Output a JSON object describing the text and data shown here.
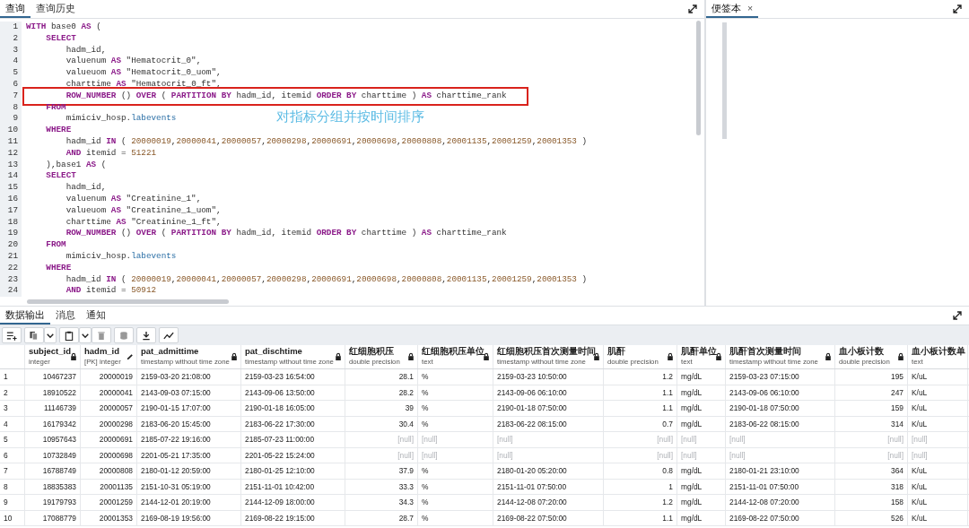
{
  "editor_tabs": [
    {
      "label": "查询",
      "selected": true
    },
    {
      "label": "查询历史",
      "selected": false
    }
  ],
  "code_lines": [
    {
      "n": "1",
      "highlighted": false,
      "tokens": [
        {
          "kind": "kw",
          "text": "WITH"
        },
        {
          "kind": "tx",
          "text": " base0 "
        },
        {
          "kind": "kw",
          "text": "AS"
        },
        {
          "kind": "tx",
          "text": " ("
        }
      ]
    },
    {
      "n": "2",
      "highlighted": false,
      "tokens": [
        {
          "kind": "kw",
          "text": "    SELECT"
        }
      ]
    },
    {
      "n": "3",
      "highlighted": false,
      "tokens": [
        {
          "kind": "tx",
          "text": "        hadm_id,"
        }
      ]
    },
    {
      "n": "4",
      "highlighted": false,
      "tokens": [
        {
          "kind": "tx",
          "text": "        valuenum "
        },
        {
          "kind": "kw",
          "text": "AS"
        },
        {
          "kind": "tx",
          "text": " \"Hematocrit_0\","
        }
      ]
    },
    {
      "n": "5",
      "highlighted": false,
      "tokens": [
        {
          "kind": "tx",
          "text": "        valueuom "
        },
        {
          "kind": "kw",
          "text": "AS"
        },
        {
          "kind": "tx",
          "text": " \"Hematocrit_0_uom\","
        }
      ]
    },
    {
      "n": "6",
      "highlighted": false,
      "tokens": [
        {
          "kind": "tx",
          "text": "        charttime "
        },
        {
          "kind": "kw",
          "text": "AS"
        },
        {
          "kind": "tx",
          "text": " \"Hematocrit_0_ft\","
        }
      ]
    },
    {
      "n": "7",
      "highlighted": true,
      "tokens": [
        {
          "kind": "kw",
          "text": "        ROW_NUMBER"
        },
        {
          "kind": "tx",
          "text": " () "
        },
        {
          "kind": "kw",
          "text": "OVER"
        },
        {
          "kind": "tx",
          "text": " ( "
        },
        {
          "kind": "kw",
          "text": "PARTITION BY"
        },
        {
          "kind": "tx",
          "text": " hadm_id, itemid "
        },
        {
          "kind": "kw",
          "text": "ORDER BY"
        },
        {
          "kind": "tx",
          "text": " charttime ) "
        },
        {
          "kind": "kw",
          "text": "AS"
        },
        {
          "kind": "tx",
          "text": " charttime_rank"
        }
      ]
    },
    {
      "n": "8",
      "highlighted": false,
      "tokens": [
        {
          "kind": "kw",
          "text": "    FROM"
        }
      ]
    },
    {
      "n": "9",
      "highlighted": false,
      "tokens": [
        {
          "kind": "tx",
          "text": "        mimiciv_hosp."
        },
        {
          "kind": "fn",
          "text": "labevents"
        }
      ]
    },
    {
      "n": "10",
      "highlighted": false,
      "tokens": [
        {
          "kind": "kw",
          "text": "    WHERE"
        }
      ]
    },
    {
      "n": "11",
      "highlighted": false,
      "tokens": [
        {
          "kind": "tx",
          "text": "        hadm_id "
        },
        {
          "kind": "kw",
          "text": "IN"
        },
        {
          "kind": "tx",
          "text": " ( "
        },
        {
          "kind": "nm",
          "text": "20000019"
        },
        {
          "kind": "tx",
          "text": ","
        },
        {
          "kind": "nm",
          "text": "20000041"
        },
        {
          "kind": "tx",
          "text": ","
        },
        {
          "kind": "nm",
          "text": "20000057"
        },
        {
          "kind": "tx",
          "text": ","
        },
        {
          "kind": "nm",
          "text": "20000298"
        },
        {
          "kind": "tx",
          "text": ","
        },
        {
          "kind": "nm",
          "text": "20000691"
        },
        {
          "kind": "tx",
          "text": ","
        },
        {
          "kind": "nm",
          "text": "20000698"
        },
        {
          "kind": "tx",
          "text": ","
        },
        {
          "kind": "nm",
          "text": "20000808"
        },
        {
          "kind": "tx",
          "text": ","
        },
        {
          "kind": "nm",
          "text": "20001135"
        },
        {
          "kind": "tx",
          "text": ","
        },
        {
          "kind": "nm",
          "text": "20001259"
        },
        {
          "kind": "tx",
          "text": ","
        },
        {
          "kind": "nm",
          "text": "20001353"
        },
        {
          "kind": "tx",
          "text": " )"
        }
      ]
    },
    {
      "n": "12",
      "highlighted": false,
      "tokens": [
        {
          "kind": "kw",
          "text": "        AND"
        },
        {
          "kind": "tx",
          "text": " itemid = "
        },
        {
          "kind": "nm",
          "text": "51221"
        }
      ]
    },
    {
      "n": "13",
      "highlighted": false,
      "tokens": [
        {
          "kind": "tx",
          "text": "    ),base1 "
        },
        {
          "kind": "kw",
          "text": "AS"
        },
        {
          "kind": "tx",
          "text": " ("
        }
      ]
    },
    {
      "n": "14",
      "highlighted": false,
      "tokens": [
        {
          "kind": "kw",
          "text": "    SELECT"
        }
      ]
    },
    {
      "n": "15",
      "highlighted": false,
      "tokens": [
        {
          "kind": "tx",
          "text": "        hadm_id,"
        }
      ]
    },
    {
      "n": "16",
      "highlighted": false,
      "tokens": [
        {
          "kind": "tx",
          "text": "        valuenum "
        },
        {
          "kind": "kw",
          "text": "AS"
        },
        {
          "kind": "tx",
          "text": " \"Creatinine_1\","
        }
      ]
    },
    {
      "n": "17",
      "highlighted": false,
      "tokens": [
        {
          "kind": "tx",
          "text": "        valueuom "
        },
        {
          "kind": "kw",
          "text": "AS"
        },
        {
          "kind": "tx",
          "text": " \"Creatinine_1_uom\","
        }
      ]
    },
    {
      "n": "18",
      "highlighted": false,
      "tokens": [
        {
          "kind": "tx",
          "text": "        charttime "
        },
        {
          "kind": "kw",
          "text": "AS"
        },
        {
          "kind": "tx",
          "text": " \"Creatinine_1_ft\","
        }
      ]
    },
    {
      "n": "19",
      "highlighted": false,
      "tokens": [
        {
          "kind": "kw",
          "text": "        ROW_NUMBER"
        },
        {
          "kind": "tx",
          "text": " () "
        },
        {
          "kind": "kw",
          "text": "OVER"
        },
        {
          "kind": "tx",
          "text": " ( "
        },
        {
          "kind": "kw",
          "text": "PARTITION BY"
        },
        {
          "kind": "tx",
          "text": " hadm_id, itemid "
        },
        {
          "kind": "kw",
          "text": "ORDER BY"
        },
        {
          "kind": "tx",
          "text": " charttime ) "
        },
        {
          "kind": "kw",
          "text": "AS"
        },
        {
          "kind": "tx",
          "text": " charttime_rank"
        }
      ]
    },
    {
      "n": "20",
      "highlighted": false,
      "tokens": [
        {
          "kind": "kw",
          "text": "    FROM"
        }
      ]
    },
    {
      "n": "21",
      "highlighted": false,
      "tokens": [
        {
          "kind": "tx",
          "text": "        mimiciv_hosp."
        },
        {
          "kind": "fn",
          "text": "labevents"
        }
      ]
    },
    {
      "n": "22",
      "highlighted": false,
      "tokens": [
        {
          "kind": "kw",
          "text": "    WHERE"
        }
      ]
    },
    {
      "n": "23",
      "highlighted": false,
      "tokens": [
        {
          "kind": "tx",
          "text": "        hadm_id "
        },
        {
          "kind": "kw",
          "text": "IN"
        },
        {
          "kind": "tx",
          "text": " ( "
        },
        {
          "kind": "nm",
          "text": "20000019"
        },
        {
          "kind": "tx",
          "text": ","
        },
        {
          "kind": "nm",
          "text": "20000041"
        },
        {
          "kind": "tx",
          "text": ","
        },
        {
          "kind": "nm",
          "text": "20000057"
        },
        {
          "kind": "tx",
          "text": ","
        },
        {
          "kind": "nm",
          "text": "20000298"
        },
        {
          "kind": "tx",
          "text": ","
        },
        {
          "kind": "nm",
          "text": "20000691"
        },
        {
          "kind": "tx",
          "text": ","
        },
        {
          "kind": "nm",
          "text": "20000698"
        },
        {
          "kind": "tx",
          "text": ","
        },
        {
          "kind": "nm",
          "text": "20000808"
        },
        {
          "kind": "tx",
          "text": ","
        },
        {
          "kind": "nm",
          "text": "20001135"
        },
        {
          "kind": "tx",
          "text": ","
        },
        {
          "kind": "nm",
          "text": "20001259"
        },
        {
          "kind": "tx",
          "text": ","
        },
        {
          "kind": "nm",
          "text": "20001353"
        },
        {
          "kind": "tx",
          "text": " )"
        }
      ]
    },
    {
      "n": "24",
      "highlighted": false,
      "tokens": [
        {
          "kind": "kw",
          "text": "        AND"
        },
        {
          "kind": "tx",
          "text": " itemid = "
        },
        {
          "kind": "nm",
          "text": "50912"
        }
      ]
    }
  ],
  "annotation": "对指标分组并按时间排序",
  "notes_panel": {
    "tabs": [
      {
        "label": "便签本",
        "close": "×",
        "selected": true
      }
    ]
  },
  "output_tabs": [
    {
      "label": "数据输出",
      "selected": true
    },
    {
      "label": "消息",
      "selected": false
    },
    {
      "label": "通知",
      "selected": false
    }
  ],
  "table": {
    "columns": [
      {
        "name": "subject_id",
        "type": "integer",
        "kind": "number"
      },
      {
        "name": "hadm_id",
        "type": "[PK] integer",
        "kind": "number"
      },
      {
        "name": "pat_admittime",
        "type": "timestamp without time zone",
        "kind": "text"
      },
      {
        "name": "pat_dischtime",
        "type": "timestamp without time zone",
        "kind": "text"
      },
      {
        "name": "红细胞积压",
        "type": "double precision",
        "kind": "number"
      },
      {
        "name": "红细胞积压单位",
        "type": "text",
        "kind": "text"
      },
      {
        "name": "红细胞积压首次测量时间",
        "type": "timestamp without time zone",
        "kind": "text"
      },
      {
        "name": "肌酐",
        "type": "double precision",
        "kind": "number"
      },
      {
        "name": "肌酐单位",
        "type": "text",
        "kind": "text"
      },
      {
        "name": "肌酐首次测量时间",
        "type": "timestamp without time zone",
        "kind": "text"
      },
      {
        "name": "血小板计数",
        "type": "double precision",
        "kind": "number"
      },
      {
        "name": "血小板计数单",
        "type": "text",
        "kind": "text"
      }
    ],
    "rows": [
      {
        "n": "1",
        "missing": false,
        "cells": [
          "10467237",
          "20000019",
          "2159-03-20 21:08:00",
          "2159-03-23 16:54:00",
          "28.1",
          "%",
          "2159-03-23 10:50:00",
          "1.2",
          "mg/dL",
          "2159-03-23 07:15:00",
          "195",
          "K/uL"
        ]
      },
      {
        "n": "2",
        "missing": false,
        "cells": [
          "18910522",
          "20000041",
          "2143-09-03 07:15:00",
          "2143-09-06 13:50:00",
          "28.2",
          "%",
          "2143-09-06 06:10:00",
          "1.1",
          "mg/dL",
          "2143-09-06 06:10:00",
          "247",
          "K/uL"
        ]
      },
      {
        "n": "3",
        "missing": false,
        "cells": [
          "11146739",
          "20000057",
          "2190-01-15 17:07:00",
          "2190-01-18 16:05:00",
          "39",
          "%",
          "2190-01-18 07:50:00",
          "1.1",
          "mg/dL",
          "2190-01-18 07:50:00",
          "159",
          "K/uL"
        ]
      },
      {
        "n": "4",
        "missing": false,
        "cells": [
          "16179342",
          "20000298",
          "2183-06-20 15:45:00",
          "2183-06-22 17:30:00",
          "30.4",
          "%",
          "2183-06-22 08:15:00",
          "0.7",
          "mg/dL",
          "2183-06-22 08:15:00",
          "314",
          "K/uL"
        ]
      },
      {
        "n": "5",
        "missing": true,
        "cells": [
          "10957643",
          "20000691",
          "2185-07-22 19:16:00",
          "2185-07-23 11:00:00",
          "[null]",
          "[null]",
          "[null]",
          "[null]",
          "[null]",
          "[null]",
          "[null]",
          "[null]"
        ]
      },
      {
        "n": "6",
        "missing": true,
        "cells": [
          "10732849",
          "20000698",
          "2201-05-21 17:35:00",
          "2201-05-22 15:24:00",
          "[null]",
          "[null]",
          "[null]",
          "[null]",
          "[null]",
          "[null]",
          "[null]",
          "[null]"
        ]
      },
      {
        "n": "7",
        "missing": false,
        "cells": [
          "16788749",
          "20000808",
          "2180-01-12 20:59:00",
          "2180-01-25 12:10:00",
          "37.9",
          "%",
          "2180-01-20 05:20:00",
          "0.8",
          "mg/dL",
          "2180-01-21 23:10:00",
          "364",
          "K/uL"
        ]
      },
      {
        "n": "8",
        "missing": false,
        "cells": [
          "18835383",
          "20001135",
          "2151-10-31 05:19:00",
          "2151-11-01 10:42:00",
          "33.3",
          "%",
          "2151-11-01 07:50:00",
          "1",
          "mg/dL",
          "2151-11-01 07:50:00",
          "318",
          "K/uL"
        ]
      },
      {
        "n": "9",
        "missing": false,
        "cells": [
          "19179793",
          "20001259",
          "2144-12-01 20:19:00",
          "2144-12-09 18:00:00",
          "34.3",
          "%",
          "2144-12-08 07:20:00",
          "1.2",
          "mg/dL",
          "2144-12-08 07:20:00",
          "158",
          "K/uL"
        ]
      },
      {
        "n": "10",
        "missing": false,
        "cells": [
          "17088779",
          "20001353",
          "2169-08-19 19:56:00",
          "2169-08-22 19:15:00",
          "28.7",
          "%",
          "2169-08-22 07:50:00",
          "1.1",
          "mg/dL",
          "2169-08-22 07:50:00",
          "526",
          "K/uL"
        ]
      }
    ]
  }
}
